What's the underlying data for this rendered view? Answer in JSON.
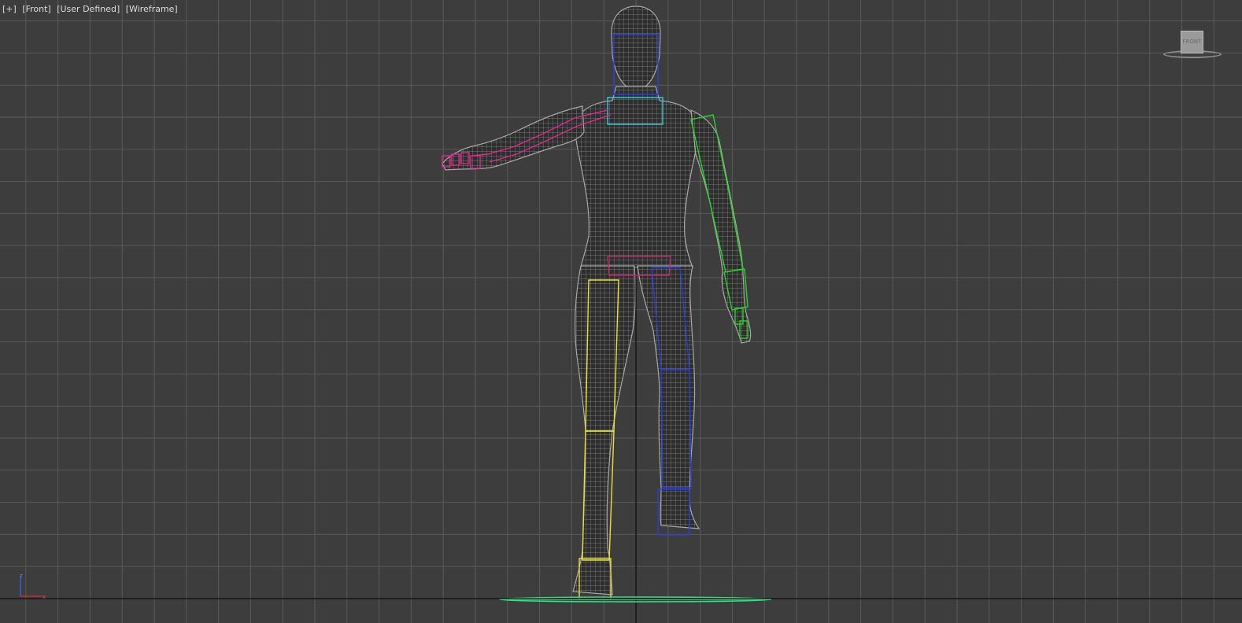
{
  "viewport": {
    "labels": [
      "[+]",
      "[Front]",
      "[User Defined]",
      "[Wireframe]"
    ],
    "viewcube_face": "FRONT",
    "axis_labels": {
      "z": "z",
      "x": "x"
    },
    "colors": {
      "background": "#3d3d3d",
      "grid": "#5a5a5a",
      "grid_axis": "#111111",
      "mesh": "#9a9a9a",
      "spine_bone": "#2a3fd8",
      "neck_bone": "#35c8d8",
      "right_arm_bones": "#e0288f",
      "left_arm_bones": "#28d428",
      "right_leg_bones": "#e6e23a",
      "left_leg_bones": "#2a3fd8",
      "pelvis_bone": "#c02a6a",
      "ground_root": "#3fd98a"
    }
  }
}
